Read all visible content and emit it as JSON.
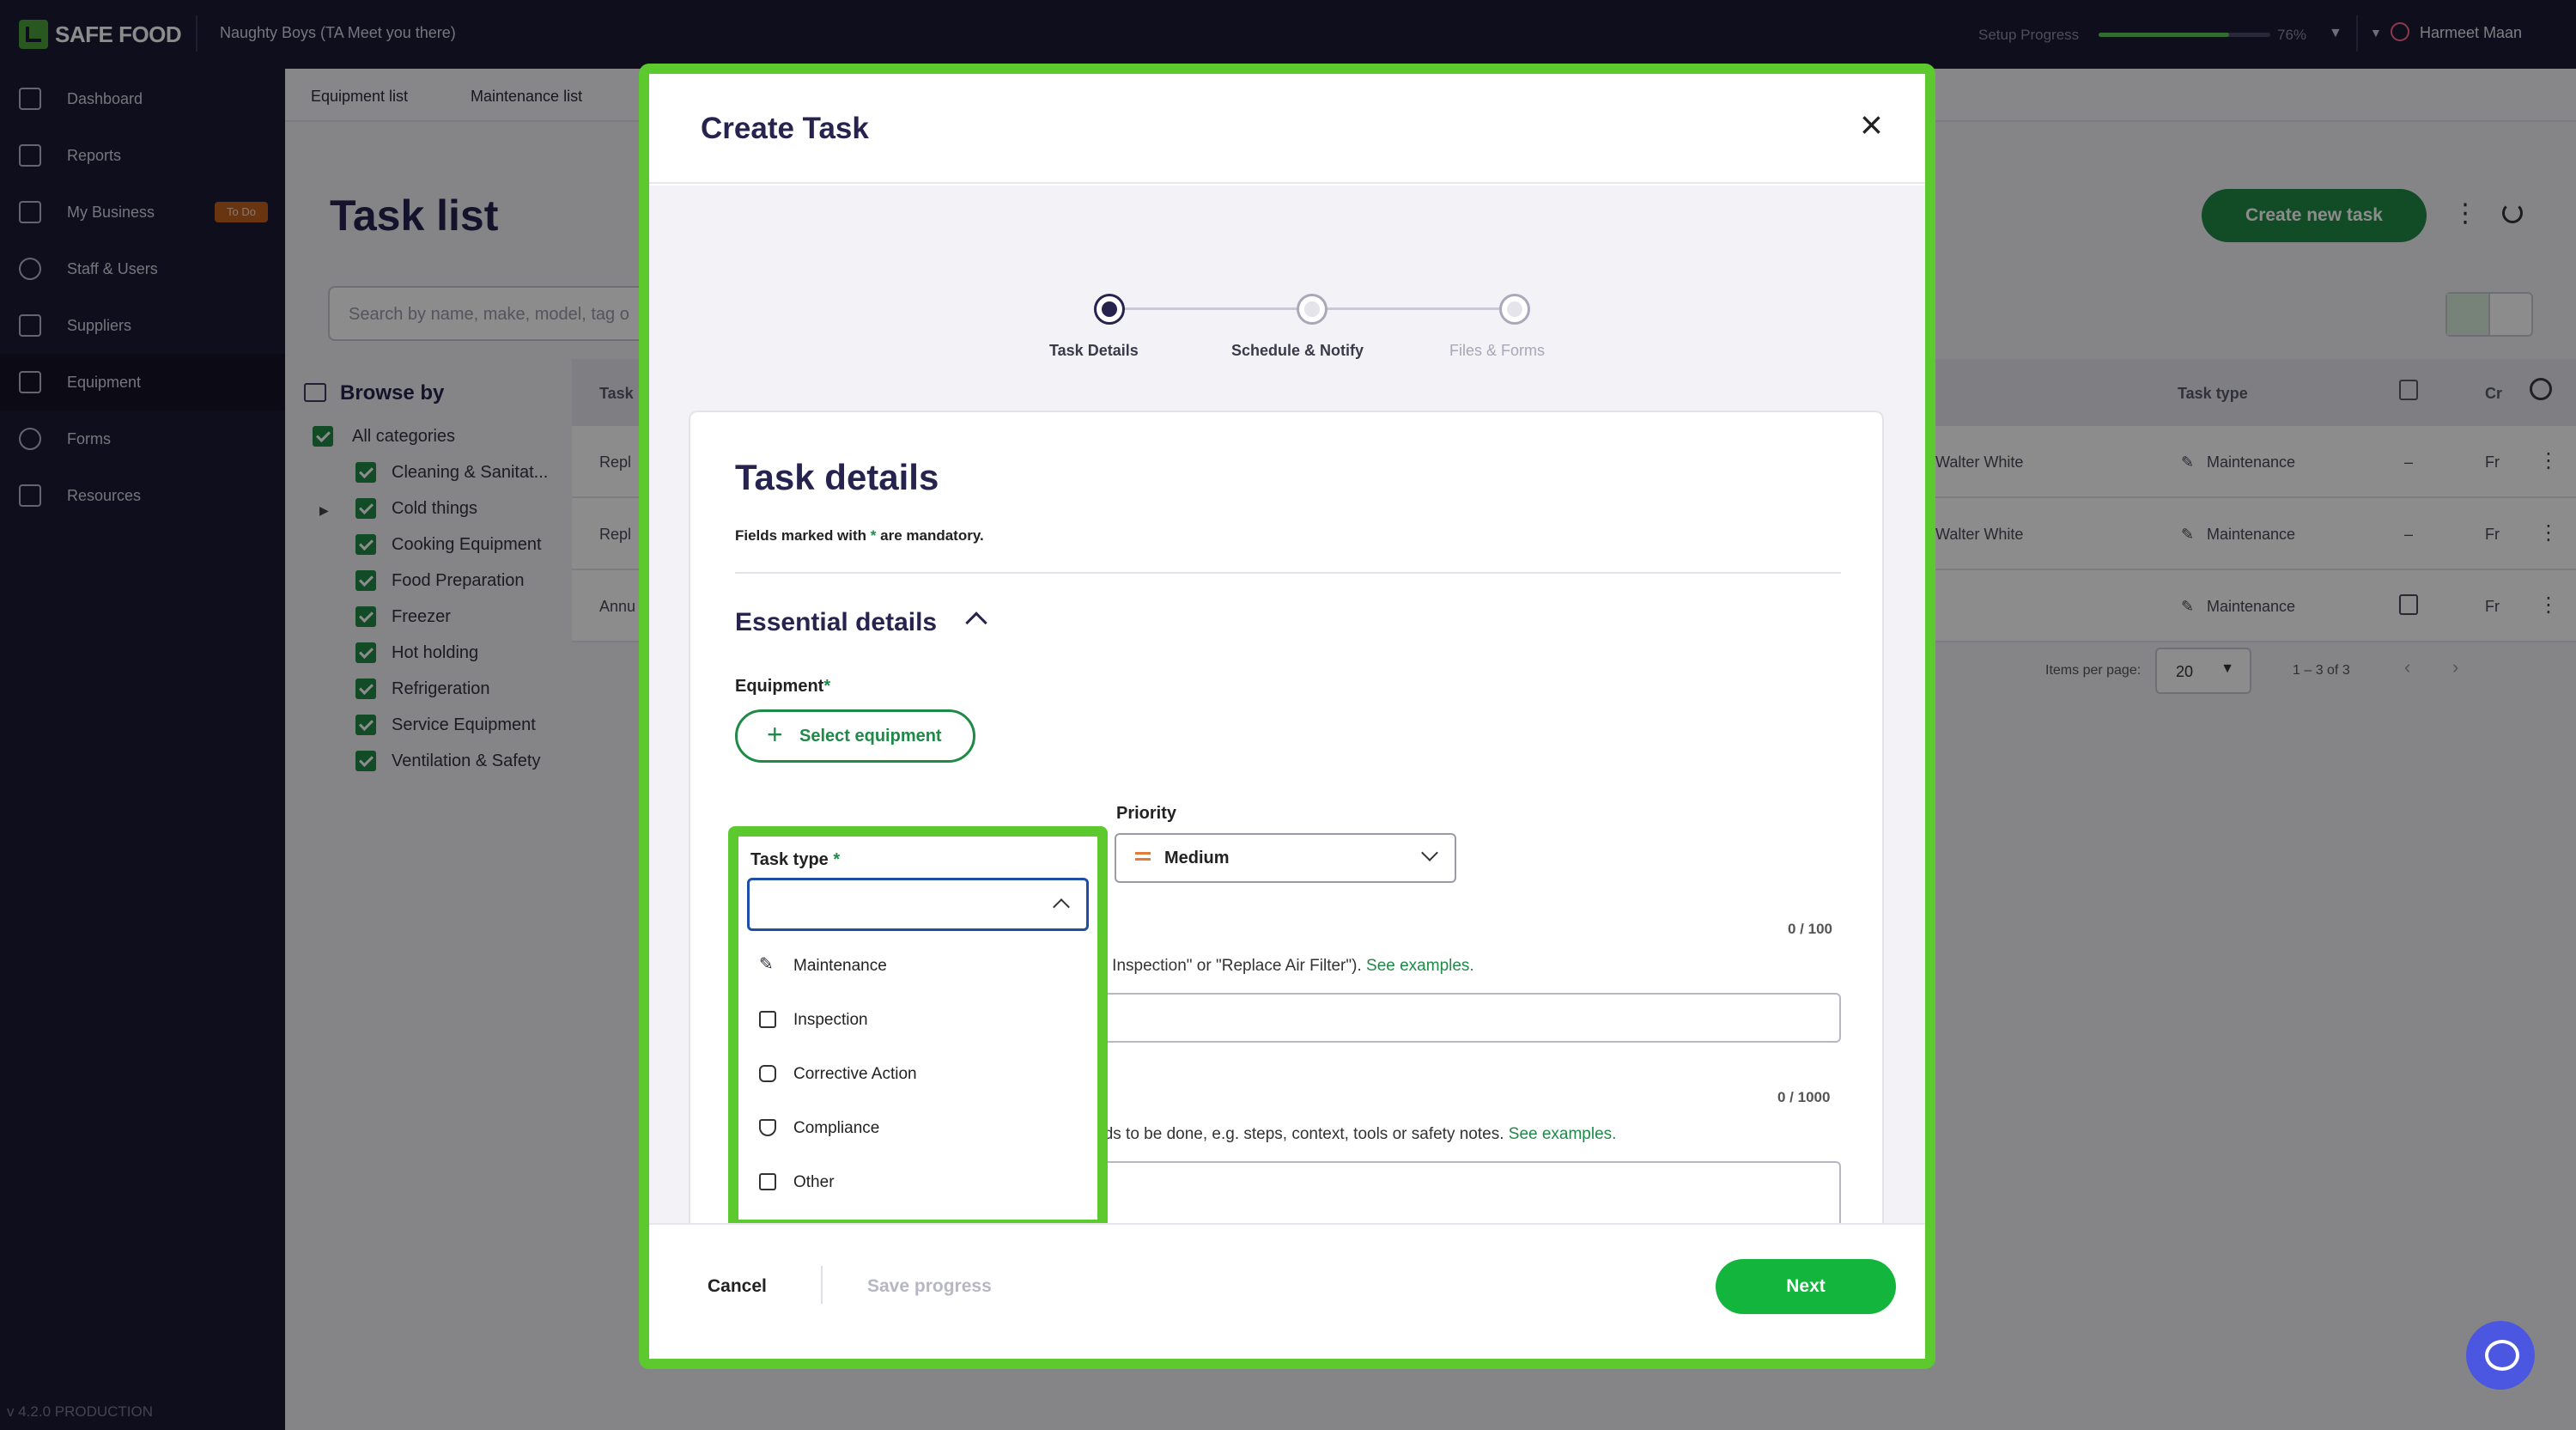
{
  "app": {
    "logo_text": "SAFE FOOD",
    "org_name": "Naughty Boys (TA Meet you there)",
    "setup_label": "Setup Progress",
    "setup_percent_text": "76%",
    "setup_progress": 0.76,
    "user_name": "Harmeet Maan",
    "version": "v 4.2.0 PRODUCTION"
  },
  "sidebar": {
    "items": [
      {
        "label": "Dashboard"
      },
      {
        "label": "Reports"
      },
      {
        "label": "My Business",
        "badge": "To Do"
      },
      {
        "label": "Staff & Users"
      },
      {
        "label": "Suppliers"
      },
      {
        "label": "Equipment"
      },
      {
        "label": "Forms"
      },
      {
        "label": "Resources"
      }
    ]
  },
  "page": {
    "tabs": [
      "Equipment list",
      "Maintenance list"
    ],
    "title": "Task list",
    "search_placeholder": "Search by name, make, model, tag o",
    "create_button": "Create new task",
    "browse_title": "Browse by",
    "categories": [
      "All categories",
      "Cleaning & Sanitat...",
      "Cold things",
      "Cooking Equipment",
      "Food Preparation",
      "Freezer",
      "Hot holding",
      "Refrigeration",
      "Service Equipment",
      "Ventilation & Safety"
    ],
    "table": {
      "col_task": "Task",
      "col_type": "Task type",
      "col_cr": "Cr",
      "rows": [
        {
          "task": "Repl",
          "assignees": "n, Walter White",
          "type": "Maintenance",
          "dash": "–",
          "cr": "Fr"
        },
        {
          "task": "Repl",
          "assignees": "n, Walter White",
          "type": "Maintenance",
          "dash": "–",
          "cr": "Fr"
        },
        {
          "task": "Annu",
          "assignees": "",
          "type": "Maintenance",
          "dash": "",
          "cr": "Fr"
        }
      ]
    },
    "pager": {
      "items_label": "Items per page:",
      "per_page": "20",
      "range": "1 – 3 of 3"
    }
  },
  "modal": {
    "title": "Create Task",
    "steps": [
      {
        "label": "Task Details",
        "active": true
      },
      {
        "label": "Schedule & Notify",
        "active": false
      },
      {
        "label": "Files & Forms",
        "active": false
      }
    ],
    "card_title": "Task details",
    "mandatory_prefix": "Fields marked with",
    "mandatory_star": "*",
    "mandatory_suffix": "are mandatory.",
    "section_title": "Essential details",
    "equipment_label": "Equipment",
    "select_equipment": "Select equipment",
    "task_type_label": "Task type",
    "priority_label": "Priority",
    "priority_value": "Medium",
    "name_counter": "0 / 100",
    "name_hint": "terly Inspection\" or \"Replace Air Filter\").",
    "name_hint_link": "See examples.",
    "desc_counter": "0 / 1000",
    "desc_hint": "needs to be done, e.g. steps, context, tools or safety notes.",
    "desc_hint_link": "See examples.",
    "task_type_options": [
      {
        "label": "Maintenance",
        "icon": "wrench-icon"
      },
      {
        "label": "Inspection",
        "icon": "checklist-icon"
      },
      {
        "label": "Corrective Action",
        "icon": "corrective-action-icon"
      },
      {
        "label": "Compliance",
        "icon": "shield-check-icon"
      },
      {
        "label": "Other",
        "icon": "other-icon"
      }
    ],
    "cancel": "Cancel",
    "save_progress": "Save progress",
    "next": "Next"
  }
}
